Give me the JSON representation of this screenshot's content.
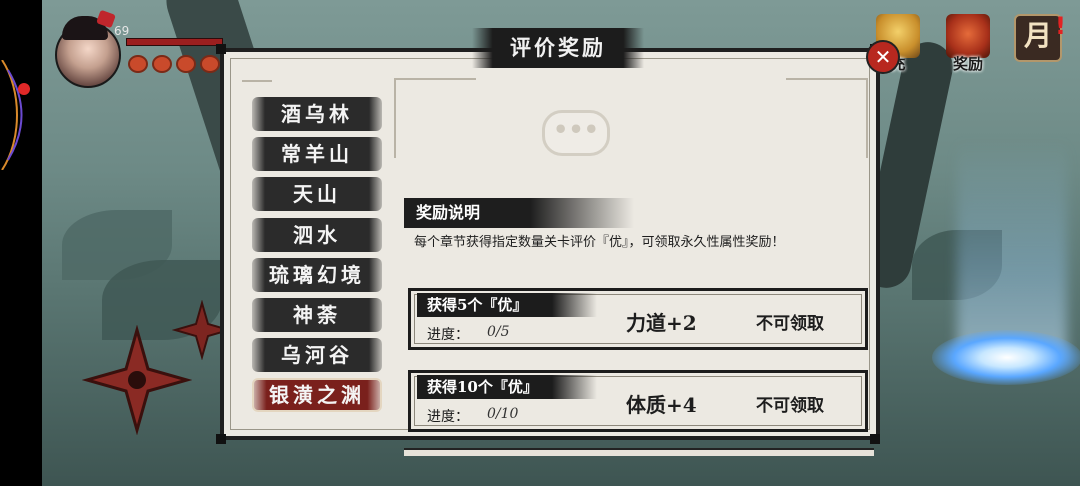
{
  "hud": {
    "level": "69",
    "buff_count": 4
  },
  "top_menu": [
    {
      "label": "充",
      "icon": "gift-box-icon"
    },
    {
      "label": "奖励",
      "icon": "reward-pouch-icon"
    },
    {
      "label": "",
      "glyph": "月",
      "icon": "monthly-card-icon",
      "badge": "!"
    }
  ],
  "dialog": {
    "title": "评价奖励",
    "close_icon": "close-icon"
  },
  "chapters": [
    {
      "label": "酒乌林",
      "selected": false
    },
    {
      "label": "常羊山",
      "selected": false
    },
    {
      "label": "天山",
      "selected": false
    },
    {
      "label": "泗水",
      "selected": false
    },
    {
      "label": "琉璃幻境",
      "selected": false
    },
    {
      "label": "神荼",
      "selected": false
    },
    {
      "label": "乌河谷",
      "selected": false
    },
    {
      "label": "银潢之渊",
      "selected": true
    }
  ],
  "info": {
    "title": "奖励说明",
    "text": "每个章节获得指定数量关卡评价『优』，可领取永久性属性奖励！"
  },
  "rewards": [
    {
      "title": "获得5个『优』",
      "progress_label": "进度：",
      "progress": "0/5",
      "bonus": "力道+2",
      "claim": "不可领取"
    },
    {
      "title": "获得10个『优』",
      "progress_label": "进度：",
      "progress": "0/10",
      "bonus": "体质+4",
      "claim": "不可领取"
    }
  ],
  "colors": {
    "selected_chapter": "#7a201c",
    "banner": "#1c1c1c",
    "panel": "#ece9e2",
    "close_button": "#b8281f"
  }
}
